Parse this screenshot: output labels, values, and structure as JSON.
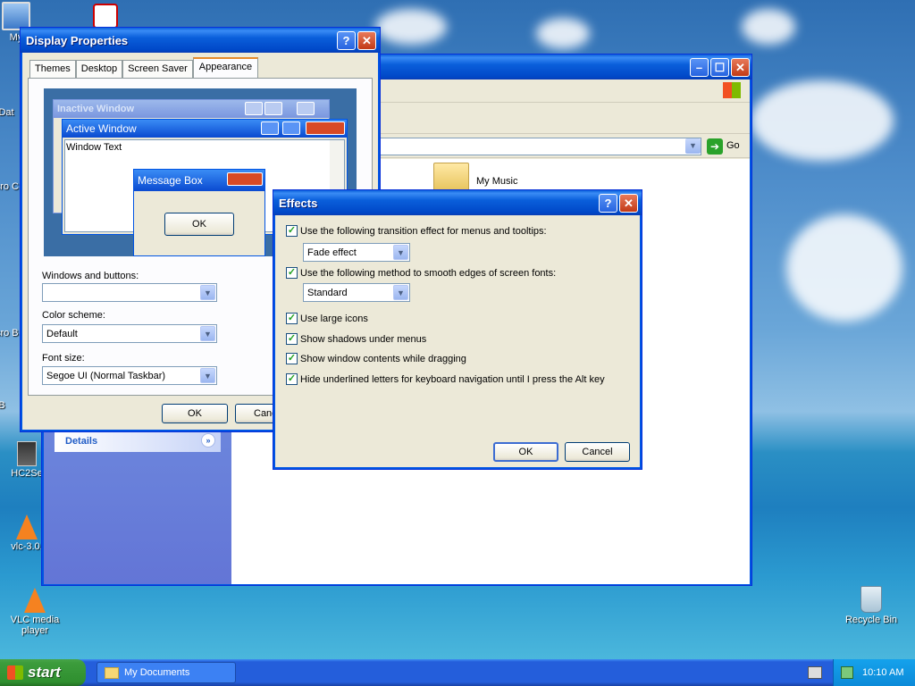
{
  "desktop": {
    "icons": [
      {
        "label": "My",
        "icon": "my-computer-icon"
      },
      {
        "label": "Dat",
        "icon": "data-icon"
      },
      {
        "label": "Micro C",
        "icon": "microsoft-icon"
      },
      {
        "label": "Micro B",
        "icon": "microsoft-icon"
      },
      {
        "label": "B",
        "icon": "folder-icon"
      },
      {
        "label": "HC2Se",
        "icon": "installer-icon"
      },
      {
        "label": "vlc-3.0.",
        "icon": "vlc-icon"
      },
      {
        "label": "VLC media player",
        "icon": "vlc-icon"
      },
      {
        "label": "Recycle Bin",
        "icon": "recycle-bin-icon"
      }
    ]
  },
  "explorer": {
    "go_label": "Go",
    "my_music": "My Music",
    "details": "Details"
  },
  "display_props": {
    "title": "Display Properties",
    "tabs": [
      "Themes",
      "Desktop",
      "Screen Saver",
      "Appearance"
    ],
    "preview": {
      "inactive": "Inactive Window",
      "active": "Active Window",
      "window_text": "Window Text",
      "message_box": "Message Box",
      "ok": "OK"
    },
    "windows_buttons_label": "Windows and buttons:",
    "windows_buttons_value": "",
    "color_scheme_label": "Color scheme:",
    "color_scheme_value": "Default",
    "font_size_label": "Font size:",
    "font_size_value": "Segoe UI (Normal Taskbar)",
    "ok": "OK",
    "cancel": "Canc"
  },
  "effects": {
    "title": "Effects",
    "transition_label": "Use the following transition effect for menus and tooltips:",
    "transition_value": "Fade effect",
    "smooth_label": "Use the following method to smooth edges of screen fonts:",
    "smooth_value": "Standard",
    "large_icons": "Use large icons",
    "shadows": "Show shadows under menus",
    "drag": "Show window contents while dragging",
    "underline": "Hide underlined letters for keyboard navigation until I press the Alt key",
    "ok": "OK",
    "cancel": "Cancel"
  },
  "taskbar": {
    "start": "start",
    "task": "My Documents",
    "time": "10:10 AM"
  }
}
